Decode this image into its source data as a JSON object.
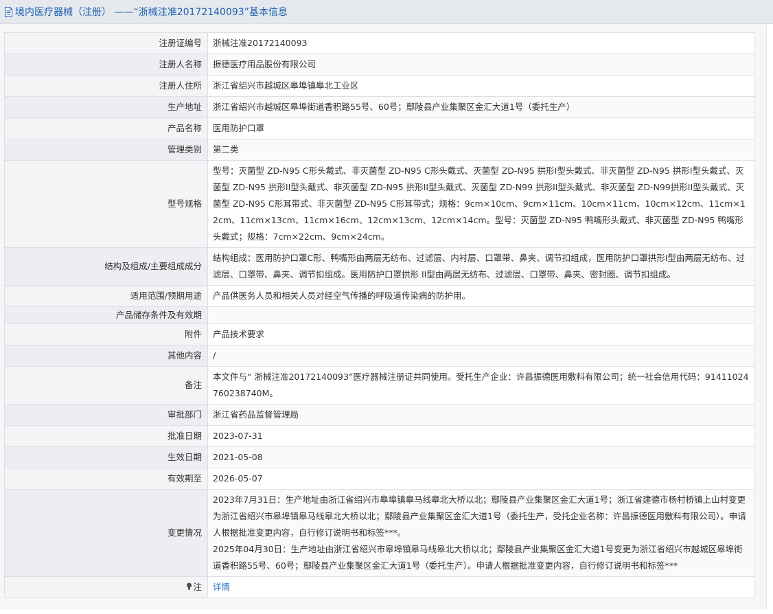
{
  "header": {
    "title": "境内医疗器械（注册） ——“浙械注准20172140093”基本信息"
  },
  "rows": [
    {
      "label": "注册证编号",
      "value": "浙械注准20172140093"
    },
    {
      "label": "注册人名称",
      "value": "振德医疗用品股份有限公司"
    },
    {
      "label": "注册人住所",
      "value": "浙江省绍兴市越城区皋埠镇皋北工业区"
    },
    {
      "label": "生产地址",
      "value": "浙江省绍兴市越城区皋埠街道香积路55号、60号；鄢陵县产业集聚区金汇大道1号（委托生产）"
    },
    {
      "label": "产品名称",
      "value": "医用防护口罩"
    },
    {
      "label": "管理类别",
      "value": "第二类"
    },
    {
      "label": "型号规格",
      "value": "型号：灭菌型 ZD-N95 C形头戴式、非灭菌型 ZD-N95 C形头戴式、灭菌型 ZD-N95 拱形I型头戴式、非灭菌型 ZD-N95 拱形I型头戴式、灭菌型 ZD-N95 拱形II型头戴式、非灭菌型 ZD-N95 拱形II型头戴式、灭菌型 ZD-N99 拱形II型头戴式、非灭菌型 ZD-N99拱形II型头戴式、灭菌型 ZD-N95 C形耳带式、非灭菌型 ZD-N95 C形耳带式；规格：9cm×10cm、9cm×11cm、10cm×11cm、10cm×12cm、11cm×12cm、11cm×13cm、11cm×16cm、12cm×13cm、12cm×14cm。型号：灭菌型 ZD-N95 鸭嘴形头戴式、非灭菌型 ZD-N95 鸭嘴形头戴式；规格：7cm×22cm、9cm×24cm。"
    },
    {
      "label": "结构及组成/主要组成成分",
      "value": "结构组成：医用防护口罩C形、鸭嘴形由两层无纺布、过滤层、内衬层、口罩带、鼻夹、调节扣组成，医用防护口罩拱形I型由两层无纺布、过滤层、口罩带、鼻夹、调节扣组成。医用防护口罩拱形 II型由两层无纺布、过滤层、口罩带、鼻夹、密封圈、调节扣组成。"
    },
    {
      "label": "适用范围/预期用途",
      "value": "产品供医务人员和相关人员对经空气传播的呼吸道传染病的防护用。"
    },
    {
      "label": "产品储存条件及有效期",
      "value": ""
    },
    {
      "label": "附件",
      "value": "产品技术要求"
    },
    {
      "label": "其他内容",
      "value": "/"
    },
    {
      "label": "备注",
      "value": "本文件与“ 浙械注准20172140093”医疗器械注册证共同使用。受托生产企业：许昌振德医用敷料有限公司；统一社会信用代码：91411024760238740M。"
    },
    {
      "label": "审批部门",
      "value": "浙江省药品监督管理局"
    },
    {
      "label": "批准日期",
      "value": "2023-07-31"
    },
    {
      "label": "生效日期",
      "value": "2021-05-08"
    },
    {
      "label": "有效期至",
      "value": "2026-05-07"
    },
    {
      "label": "变更情况",
      "value": "2023年7月31日：生产地址由浙江省绍兴市皋埠镇皋马线皋北大桥以北；鄢陵县产业集聚区金汇大道1号；浙江省建德市杨村桥镇上山村变更为浙江省绍兴市皋埠镇皋马线皋北大桥以北；鄢陵县产业集聚区金汇大道1号（委托生产，受托企业名称：许昌振德医用敷料有限公司）。申请人根据批准变更内容，自行修订说明书和标签***。\n2025年04月30日：生产地址由浙江省绍兴市皋埠镇皋马线皋北大桥以北；鄢陵县产业集聚区金汇大道1号变更为浙江省绍兴市越城区皋埠街道香积路55号、60号；鄢陵县产业集聚区金汇大道1号（委托生产）。申请人根据批准变更内容，自行修订说明书和标签***"
    }
  ],
  "note": {
    "label": "注",
    "link_text": "详情",
    "icon": "bulb-icon"
  },
  "colors": {
    "link": "#2a6ebb",
    "title": "#1e5fb0",
    "border": "#dcdfe4"
  }
}
